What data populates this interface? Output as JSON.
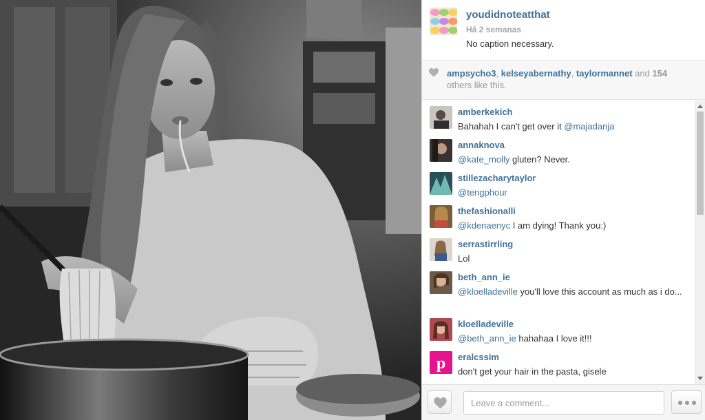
{
  "post": {
    "author": "youdidnoteatthat",
    "time": "Há 2 semanas",
    "caption": "No caption necessary.",
    "avatar_icon": "macarons-avatar"
  },
  "likes": {
    "users": [
      "ampsycho3",
      "kelseyabernathy",
      "taylormannet"
    ],
    "sep1": ", ",
    "sep2": ", ",
    "and": " and ",
    "count": "154",
    "suffix": " others like this."
  },
  "comments": [
    {
      "user": "amberkekich",
      "mention": "@majadanja",
      "text_before": "Bahahah I can't get over it ",
      "text_after": ""
    },
    {
      "user": "annaknova",
      "mention": "@kate_molly",
      "text_before": "",
      "text_after": " gluten? Never."
    },
    {
      "user": "stillezacharytaylor",
      "mention": "@tengphour",
      "text_before": "",
      "text_after": ""
    },
    {
      "user": "thefashionalli",
      "mention": "@kdenaenyc",
      "text_before": "",
      "text_after": " I am dying! Thank you:)"
    },
    {
      "user": "serrastirrling",
      "mention": "",
      "text_before": "Lol",
      "text_after": ""
    },
    {
      "user": "beth_ann_ie",
      "mention": "@kloelladeville",
      "text_before": "",
      "text_after": " you'll love this account as much as i do..."
    },
    {
      "user": "kloelladeville",
      "mention": "@beth_ann_ie",
      "text_before": "",
      "text_after": " hahahaa I love it!!!"
    },
    {
      "user": "eralcssim",
      "mention": "",
      "text_before": "don't get your hair in the pasta, gisele",
      "text_after": ""
    }
  ],
  "footer": {
    "comment_placeholder": "Leave a comment...",
    "like_icon": "heart-icon",
    "more_icon": "more-dots-icon"
  },
  "colors": {
    "username": "#3f729b",
    "muted": "#a5a5a5",
    "text": "#333333"
  }
}
